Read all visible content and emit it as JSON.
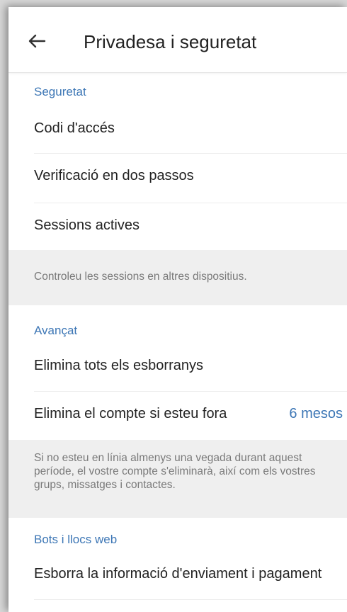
{
  "header": {
    "back_icon": "arrow-left-icon",
    "title": "Privadesa i seguretat"
  },
  "sections": {
    "security": {
      "title": "Seguretat",
      "items": [
        {
          "label": "Codi d'accés"
        },
        {
          "label": "Verificació en dos passos"
        },
        {
          "label": "Sessions actives"
        }
      ],
      "info": "Controleu les sessions en altres dispositius."
    },
    "advanced": {
      "title": "Avançat",
      "items": [
        {
          "label": "Elimina tots els esborranys"
        },
        {
          "label": "Elimina el compte si esteu fora",
          "value": "6 mesos"
        }
      ],
      "info": "Si no esteu en línia almenys una vegada durant aquest període, el vostre compte s'eliminarà, així com els vostres grups, missatges i contactes."
    },
    "bots": {
      "title": "Bots i llocs web",
      "items": [
        {
          "label": "Esborra la informació d'enviament i pagament"
        }
      ]
    }
  },
  "colors": {
    "accent": "#3c76b5",
    "text": "#222222",
    "muted": "#7a7a7a",
    "info_bg": "#efefef"
  }
}
